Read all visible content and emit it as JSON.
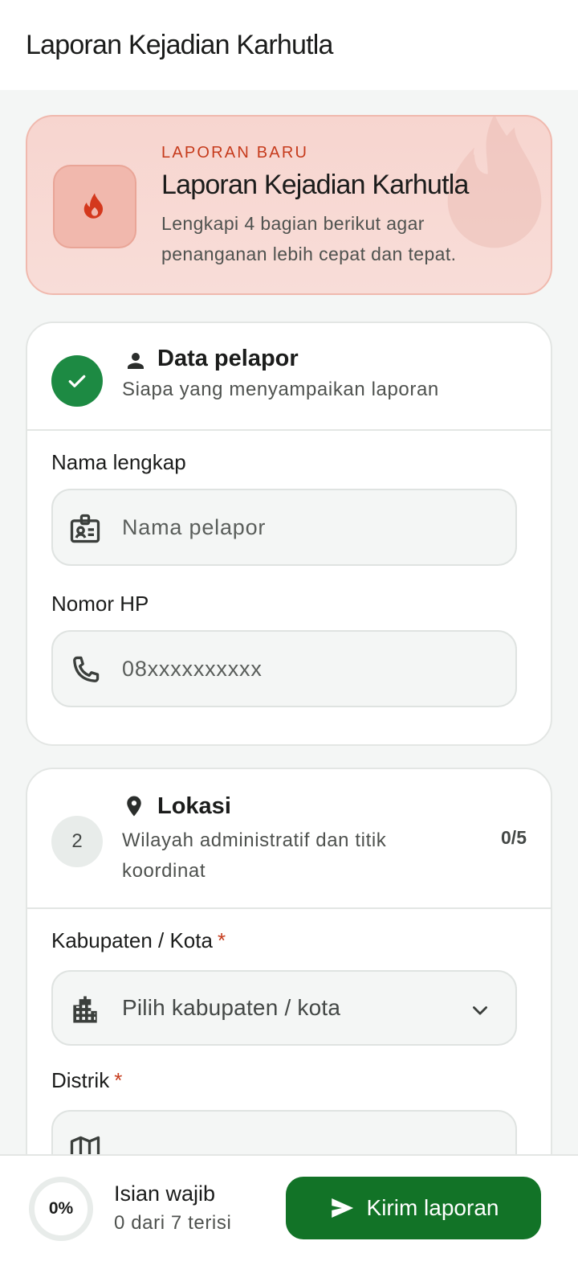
{
  "appbar": {
    "title": "Laporan Kejadian Karhutla"
  },
  "hero": {
    "eyebrow": "LAPORAN BARU",
    "title": "Laporan Kejadian Karhutla",
    "description": "Lengkapi 4 bagian berikut agar penanganan lebih cepat dan tepat.",
    "icon": "fire-icon"
  },
  "sections": [
    {
      "status": "complete",
      "icon": "person-icon",
      "title": "Data pelapor",
      "subtitle": "Siapa yang menyampaikan laporan",
      "fields": [
        {
          "label": "Nama lengkap",
          "placeholder": "Nama pelapor",
          "icon": "id-badge-icon"
        },
        {
          "label": "Nomor HP",
          "placeholder": "08xxxxxxxxxx",
          "icon": "phone-icon"
        }
      ]
    },
    {
      "step": "2",
      "icon": "location-pin-icon",
      "title": "Lokasi",
      "subtitle": "Wilayah administratif dan titik koordinat",
      "count": "0/5",
      "fields": [
        {
          "label": "Kabupaten / Kota",
          "required": "*",
          "placeholder": "Pilih kabupaten / kota",
          "icon": "city-icon"
        },
        {
          "label": "Distrik",
          "required": "*",
          "placeholder": "",
          "icon": "map-icon"
        }
      ]
    }
  ],
  "footer": {
    "progress_percent": "0%",
    "progress_fraction": 0,
    "title": "Isian wajib",
    "subtitle": "0 dari 7 terisi",
    "submit_label": "Kirim laporan",
    "submit_icon": "send-icon"
  },
  "colors": {
    "accent_green": "#127327",
    "accent_red": "#c63b1c",
    "hero_bg": "#f7d5cf"
  }
}
